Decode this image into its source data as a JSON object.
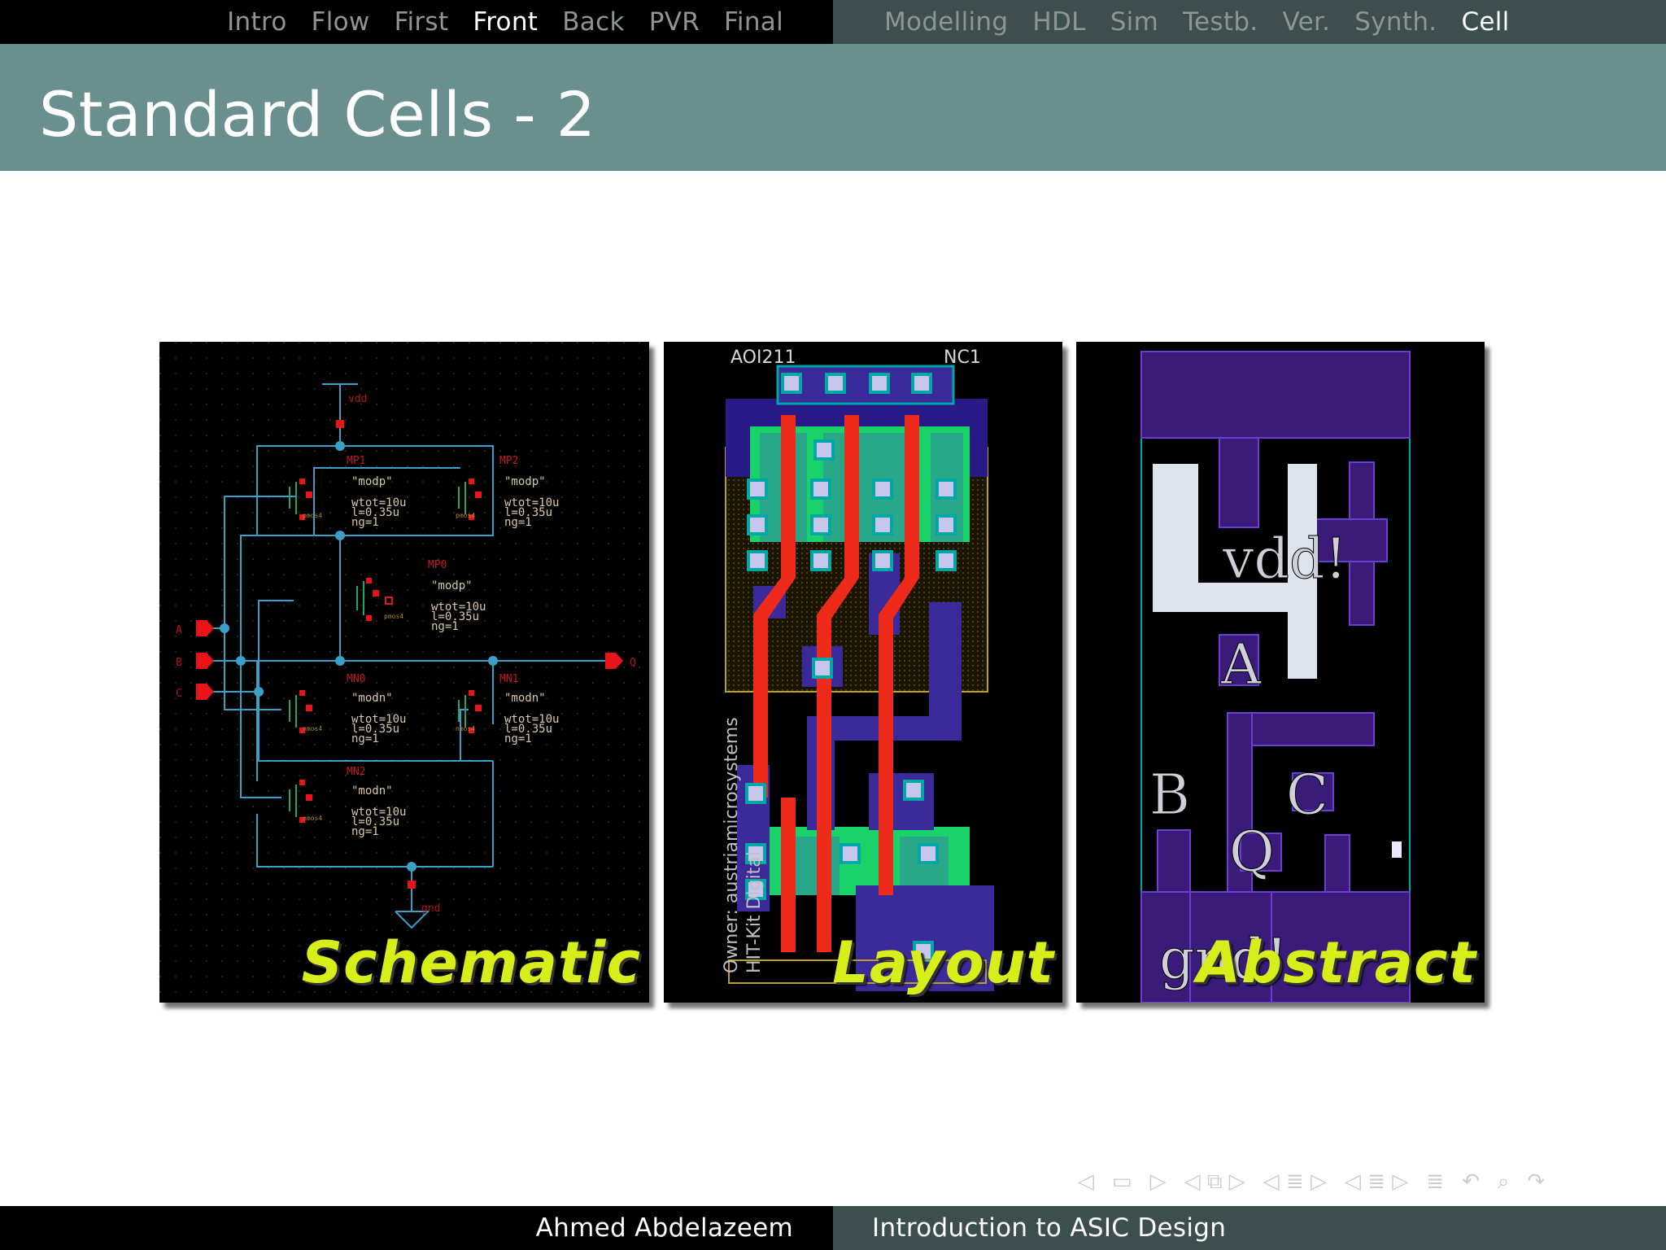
{
  "nav": {
    "sections_left": [
      "Intro",
      "Flow",
      "First",
      "Front",
      "Back",
      "PVR",
      "Final"
    ],
    "sections_right": [
      "Modelling",
      "HDL",
      "Sim",
      "Testb.",
      "Ver.",
      "Synth.",
      "Cell"
    ],
    "active_left": "Front",
    "active_right": "Cell"
  },
  "frame": {
    "title": "Standard Cells - 2"
  },
  "figures": {
    "schematic": {
      "label": "Schematic",
      "texts": {
        "vdd": "vdd",
        "gnd": "gnd",
        "in_a": "A",
        "in_b": "B",
        "in_c": "C",
        "out_q": "Q",
        "mp1": "MP1",
        "mp2": "MP2",
        "mp0": "MP0",
        "mn0": "MN0",
        "mn1": "MN1",
        "mn2": "MN2",
        "modp": "\"modp\"",
        "modn": "\"modn\"",
        "wtot": "wtot=10u",
        "l": "l=0.35u",
        "ng": "ng=1",
        "pmos4": "pmos4",
        "nmos4": "nmos4"
      }
    },
    "layout": {
      "label": "Layout",
      "cell_name": "AOI211",
      "corner_label": "NC1",
      "owner": "Owner: austriamicrosystems",
      "group": "HIT-Kit Digital"
    },
    "abstract": {
      "label": "Abstract",
      "pins": {
        "vdd": "vdd!",
        "gnd": "gnd!",
        "a": "A",
        "b": "B",
        "c": "C",
        "q": "Q"
      }
    }
  },
  "footer": {
    "author": "Ahmed Abdelazeem",
    "talk_title": "Introduction to ASIC Design"
  },
  "colors": {
    "nav_left_bg": "#000000",
    "nav_right_bg": "#3c4e4e",
    "title_band": "#6a8f8f",
    "label_yellow": "#d8ee1a",
    "schematic_wire": "#3aa0c8",
    "schematic_pin": "#ff0000",
    "layout_poly": "#ee2a1a",
    "layout_diff": "#19d36a",
    "layout_metal1": "#3a2a9a",
    "layout_contact": "#c7c7ee"
  },
  "icons": [
    "arrow-left-icon",
    "frame-icon",
    "arrow-right-icon",
    "subsection-icon",
    "section-icon",
    "outline-icon",
    "undo-icon",
    "search-icon",
    "redo-icon"
  ]
}
